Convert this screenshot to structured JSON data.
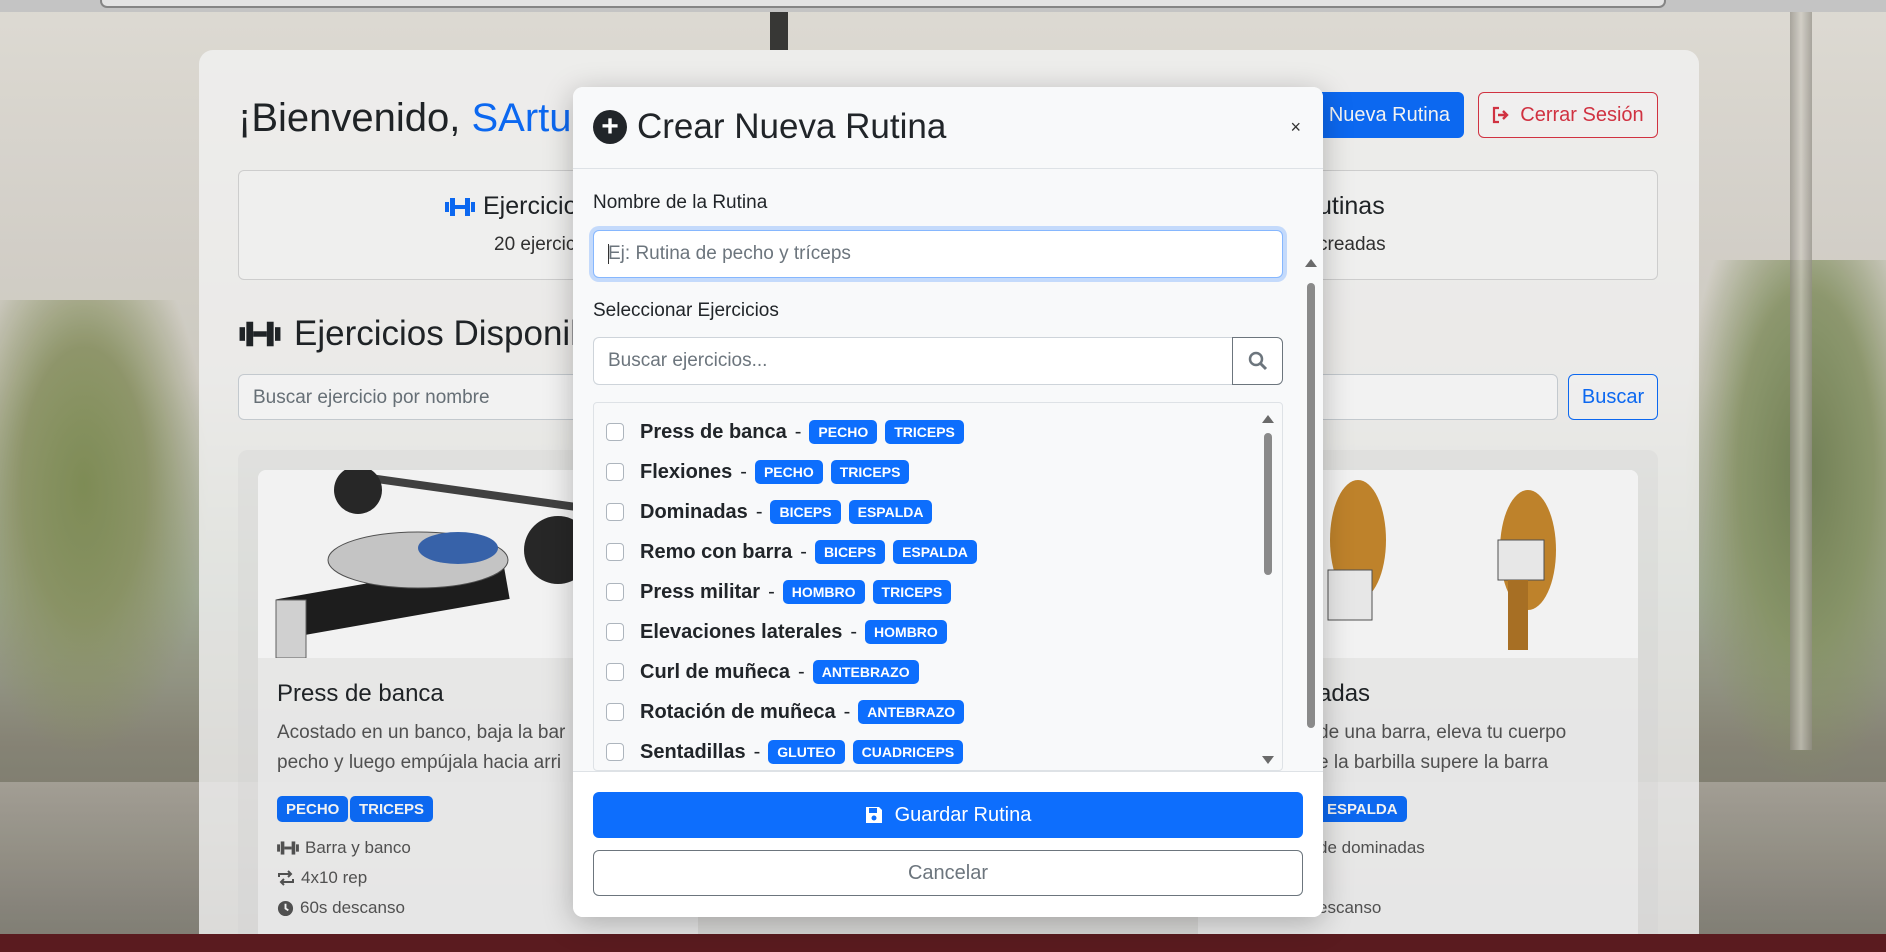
{
  "header": {
    "welcome_prefix": "¡Bienvenido,",
    "username": "SArtu",
    "new_routine_label": "Nueva Rutina",
    "logout_label": "Cerrar Sesión"
  },
  "stats": {
    "exercises_title": "Ejercicio",
    "exercises_sub": "20 ejercic",
    "routines_title": "utinas",
    "routines_sub": "creadas"
  },
  "section": {
    "title": "Ejercicios Disponil",
    "search_placeholder": "Buscar ejercicio por nombre",
    "search_button": "Buscar"
  },
  "cards": [
    {
      "title": "Press de banca",
      "desc_line1": "Acostado en un banco, baja la bar",
      "desc_line2": "pecho y luego empújala hacia arri",
      "tags": [
        "PECHO",
        "TRICEPS"
      ],
      "equipment": "Barra y banco",
      "reps": "4x10 rep",
      "rest": "60s descanso"
    },
    {
      "title": "adas",
      "desc_line1": "de una barra, eleva tu cuerpo",
      "desc_line2": "e la barbilla supere la barra",
      "tags": [
        "ESPALDA"
      ],
      "equipment": "de dominadas",
      "rest": "escanso"
    }
  ],
  "modal": {
    "title": "Crear Nueva Rutina",
    "close_symbol": "×",
    "name_label": "Nombre de la Rutina",
    "name_placeholder": "Ej: Rutina de pecho y tríceps",
    "select_label": "Seleccionar Ejercicios",
    "search_placeholder": "Buscar ejercicios...",
    "save_label": "Guardar Rutina",
    "cancel_label": "Cancelar",
    "exercises": [
      {
        "name": "Press de banca",
        "tags": [
          "PECHO",
          "TRICEPS"
        ]
      },
      {
        "name": "Flexiones",
        "tags": [
          "PECHO",
          "TRICEPS"
        ]
      },
      {
        "name": "Dominadas",
        "tags": [
          "BICEPS",
          "ESPALDA"
        ]
      },
      {
        "name": "Remo con barra",
        "tags": [
          "BICEPS",
          "ESPALDA"
        ]
      },
      {
        "name": "Press militar",
        "tags": [
          "HOMBRO",
          "TRICEPS"
        ]
      },
      {
        "name": "Elevaciones laterales",
        "tags": [
          "HOMBRO"
        ]
      },
      {
        "name": "Curl de muñeca",
        "tags": [
          "ANTEBRAZO"
        ]
      },
      {
        "name": "Rotación de muñeca",
        "tags": [
          "ANTEBRAZO"
        ]
      },
      {
        "name": "Sentadillas",
        "tags": [
          "GLUTEO",
          "CUADRICEPS"
        ]
      }
    ],
    "separator": "-"
  },
  "colors": {
    "primary": "#0d6efd",
    "danger": "#dc3545",
    "secondary": "#6c757d"
  },
  "icons": {
    "dumbbell": "dumbbell-icon",
    "plus": "plus-circle-icon",
    "search": "search-icon",
    "save": "save-icon",
    "logout": "logout-icon",
    "repeat": "repeat-icon",
    "clock": "clock-icon"
  }
}
